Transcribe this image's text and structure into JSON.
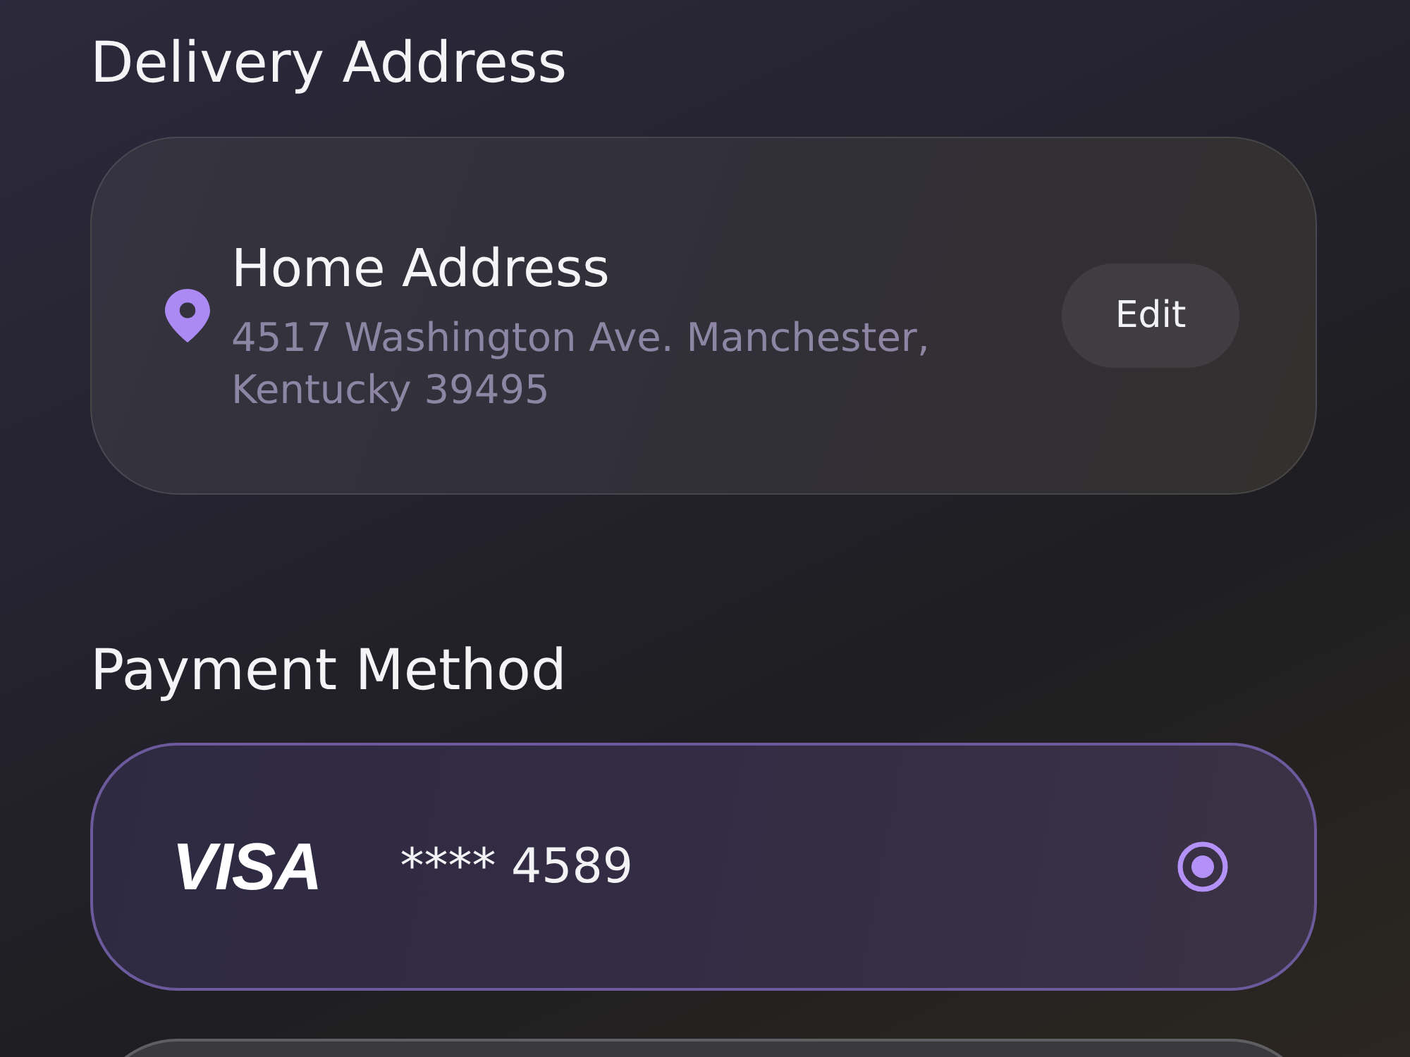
{
  "delivery": {
    "heading": "Delivery Address",
    "address": {
      "title": "Home Address",
      "text": "4517 Washington Ave. Manchester, Kentucky 39495",
      "button": "Edit"
    }
  },
  "payment": {
    "heading": "Payment Method",
    "methods": [
      {
        "brand": "VISA",
        "number": "**** 4589",
        "selected": true
      },
      {
        "selected": false
      }
    ]
  }
}
